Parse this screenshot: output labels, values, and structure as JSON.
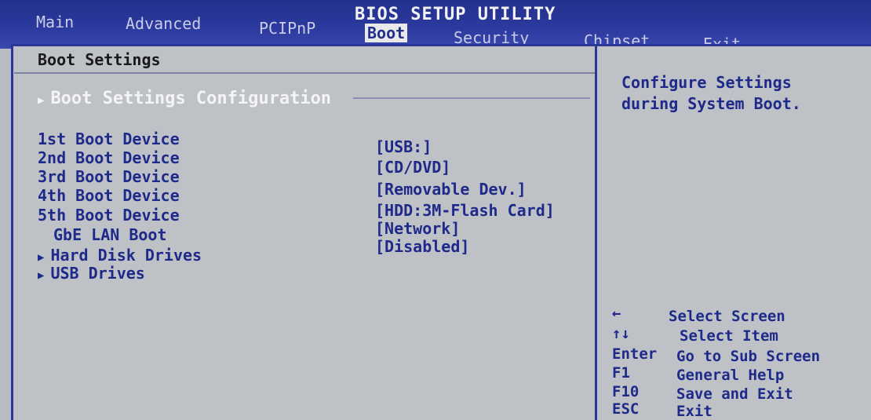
{
  "title": "BIOS SETUP UTILITY",
  "tabs": [
    {
      "label": "Main"
    },
    {
      "label": "Advanced"
    },
    {
      "label": "PCIPnP"
    },
    {
      "label": "Boot"
    },
    {
      "label": "Security"
    },
    {
      "label": "Chipset"
    },
    {
      "label": "Exit"
    }
  ],
  "section_title": "Boot Settings",
  "config_item": "Boot Settings Configuration",
  "boot_items": [
    {
      "label": "1st Boot Device",
      "value": "[USB:]"
    },
    {
      "label": "2nd Boot Device",
      "value": "[CD/DVD]"
    },
    {
      "label": "3rd Boot Device",
      "value": "[Removable Dev.]"
    },
    {
      "label": "4th Boot Device",
      "value": "[HDD:3M-Flash Card]"
    },
    {
      "label": "5th Boot Device",
      "value": "[Network]"
    },
    {
      "label": "GbE LAN Boot",
      "value": "[Disabled]"
    }
  ],
  "submenus": [
    "Hard Disk Drives",
    "USB Drives"
  ],
  "help_text": "Configure Settings\nduring System Boot.",
  "keys": [
    {
      "key": "←",
      "desc": "Select Screen"
    },
    {
      "key": "↑↓",
      "desc": "Select Item"
    },
    {
      "key": "Enter",
      "desc": "Go to Sub Screen"
    },
    {
      "key": "F1",
      "desc": "General Help"
    },
    {
      "key": "F10",
      "desc": "Save and Exit"
    },
    {
      "key": "ESC",
      "desc": "Exit"
    }
  ],
  "colors": {
    "header_blue": "#2d3aa0",
    "panel_gray": "#bec1c6",
    "text_blue": "#1e2a8a"
  }
}
